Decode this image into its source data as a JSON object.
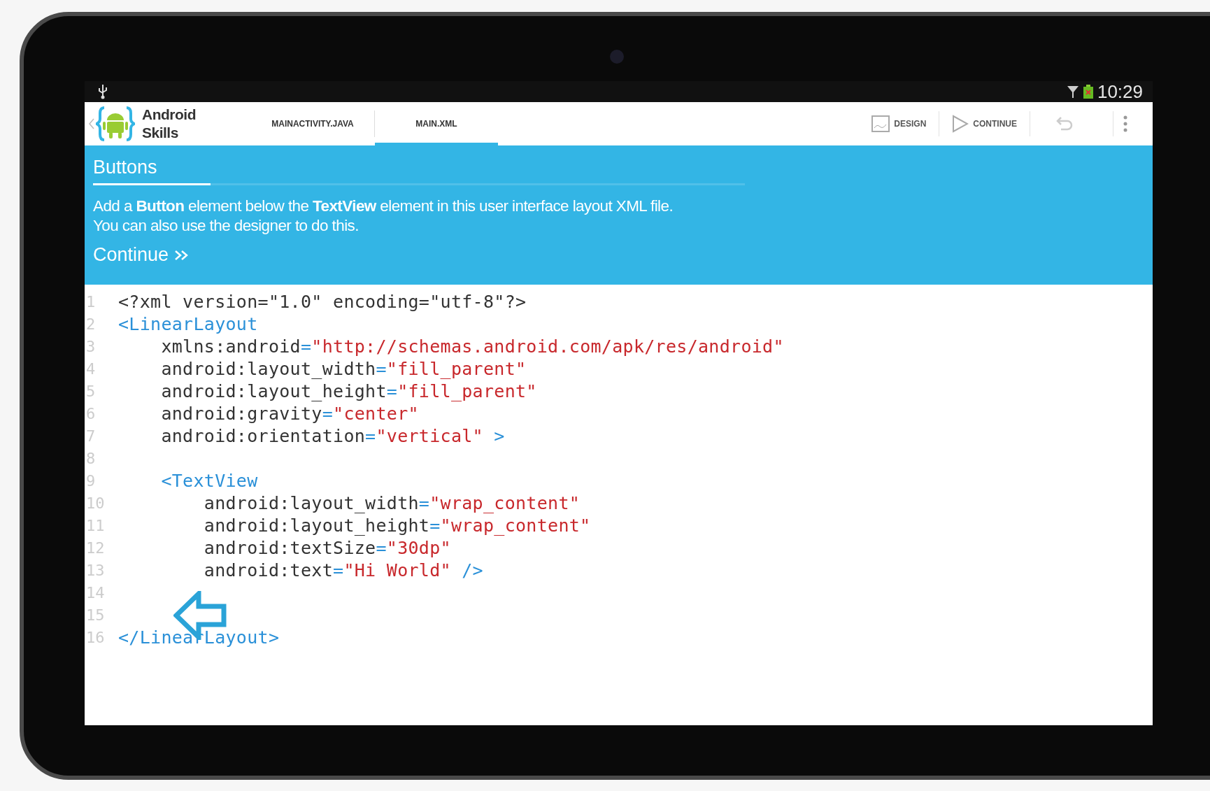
{
  "status_bar": {
    "time": "10:29"
  },
  "action_bar": {
    "app_title": "Android Skills",
    "tabs": [
      {
        "label": "MAINACTIVITY.JAVA",
        "selected": false
      },
      {
        "label": "MAIN.XML",
        "selected": true
      }
    ],
    "actions": [
      {
        "kind": "design",
        "label": "DESIGN"
      },
      {
        "kind": "continue",
        "label": "CONTINUE"
      },
      {
        "kind": "undo"
      },
      {
        "kind": "overflow"
      }
    ]
  },
  "lesson": {
    "title": "Buttons",
    "instructions": [
      "Add a **Button** element below the **TextView** element in this user interface layout XML file.",
      "You can also use the designer to do this."
    ],
    "continue_link": "Continue"
  },
  "editor": {
    "lines": [
      {
        "number": "1",
        "tokens": [
          {
            "kind": "plain",
            "text": "<?xml version=\"1.0\" encoding=\"utf-8\"?>"
          }
        ]
      },
      {
        "number": "2",
        "tokens": [
          {
            "kind": "tag",
            "text": "<LinearLayout"
          }
        ]
      },
      {
        "number": "3",
        "tokens": [
          {
            "kind": "attr",
            "text": "    xmlns:android"
          },
          {
            "kind": "eq",
            "text": "="
          },
          {
            "kind": "value",
            "text": "\"http://schemas.android.com/apk/res/android\""
          }
        ]
      },
      {
        "number": "4",
        "tokens": [
          {
            "kind": "attr",
            "text": "    android:layout_width"
          },
          {
            "kind": "eq",
            "text": "="
          },
          {
            "kind": "value",
            "text": "\"fill_parent\""
          }
        ]
      },
      {
        "number": "5",
        "tokens": [
          {
            "kind": "attr",
            "text": "    android:layout_height"
          },
          {
            "kind": "eq",
            "text": "="
          },
          {
            "kind": "value",
            "text": "\"fill_parent\""
          }
        ]
      },
      {
        "number": "6",
        "tokens": [
          {
            "kind": "attr",
            "text": "    android:gravity"
          },
          {
            "kind": "eq",
            "text": "="
          },
          {
            "kind": "value",
            "text": "\"center\""
          }
        ]
      },
      {
        "number": "7",
        "tokens": [
          {
            "kind": "attr",
            "text": "    android:orientation"
          },
          {
            "kind": "eq",
            "text": "="
          },
          {
            "kind": "value",
            "text": "\"vertical\""
          },
          {
            "kind": "tag",
            "text": " >"
          }
        ]
      },
      {
        "number": "8"
      },
      {
        "number": "9",
        "tokens": [
          {
            "kind": "tag",
            "text": "    <TextView"
          }
        ]
      },
      {
        "number": "10",
        "tokens": [
          {
            "kind": "attr",
            "text": "        android:layout_width"
          },
          {
            "kind": "eq",
            "text": "="
          },
          {
            "kind": "value",
            "text": "\"wrap_content\""
          }
        ]
      },
      {
        "number": "11",
        "tokens": [
          {
            "kind": "attr",
            "text": "        android:layout_height"
          },
          {
            "kind": "eq",
            "text": "="
          },
          {
            "kind": "value",
            "text": "\"wrap_content\""
          }
        ]
      },
      {
        "number": "12",
        "tokens": [
          {
            "kind": "attr",
            "text": "        android:textSize"
          },
          {
            "kind": "eq",
            "text": "="
          },
          {
            "kind": "value",
            "text": "\"30dp\""
          }
        ]
      },
      {
        "number": "13",
        "tokens": [
          {
            "kind": "attr",
            "text": "        android:text"
          },
          {
            "kind": "eq",
            "text": "="
          },
          {
            "kind": "value",
            "text": "\"Hi World\""
          },
          {
            "kind": "tag",
            "text": " />"
          }
        ]
      },
      {
        "number": "14"
      },
      {
        "number": "15"
      },
      {
        "number": "16",
        "tokens": [
          {
            "kind": "tag",
            "text": "</LinearLayout>"
          }
        ]
      }
    ]
  }
}
